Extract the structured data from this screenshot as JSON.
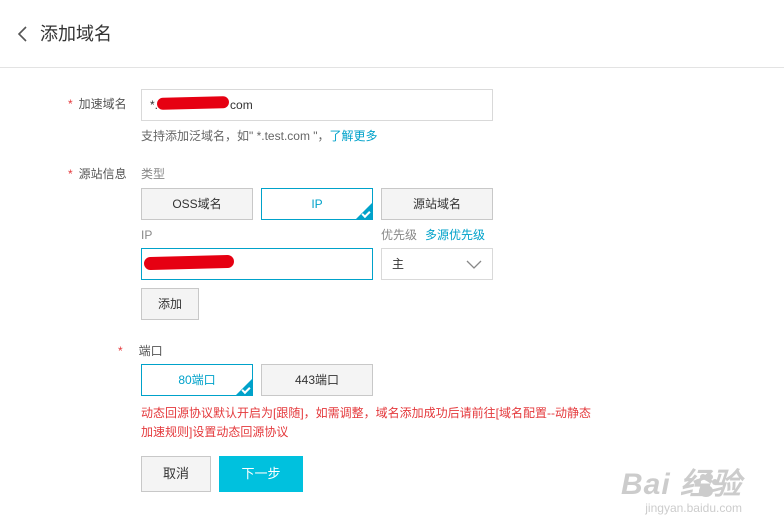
{
  "header": {
    "title": "添加域名"
  },
  "form": {
    "required_mark": "*",
    "domain": {
      "label": "加速域名",
      "value_prefix": "*.",
      "value_suffix": "com",
      "hint_text": "支持添加泛域名，如\" *.test.com \"，",
      "hint_link": "了解更多"
    },
    "origin": {
      "label": "源站信息",
      "type_label": "类型",
      "types": [
        "OSS域名",
        "IP",
        "源站域名"
      ],
      "selected_type": "IP",
      "ip_label": "IP",
      "priority_label": "优先级",
      "priority_link": "多源优先级",
      "priority_value": "主",
      "add_button": "添加"
    },
    "port": {
      "label": "端口",
      "options": [
        "80端口",
        "443端口"
      ],
      "selected": "80端口",
      "notice_line1": "动态回源协议默认开启为[跟随]，如需调整，域名添加成功后请前往[域名配置--动静态",
      "notice_line2": "加速规则]设置动态回源协议"
    },
    "actions": {
      "cancel": "取消",
      "next": "下一步"
    }
  },
  "watermark": {
    "main": "Bai 经验",
    "sub": "jingyan.baidu.com"
  },
  "colors": {
    "accent": "#00a2ca",
    "primary_button": "#00c1de",
    "error": "#e4393c",
    "redaction": "#e60012"
  }
}
